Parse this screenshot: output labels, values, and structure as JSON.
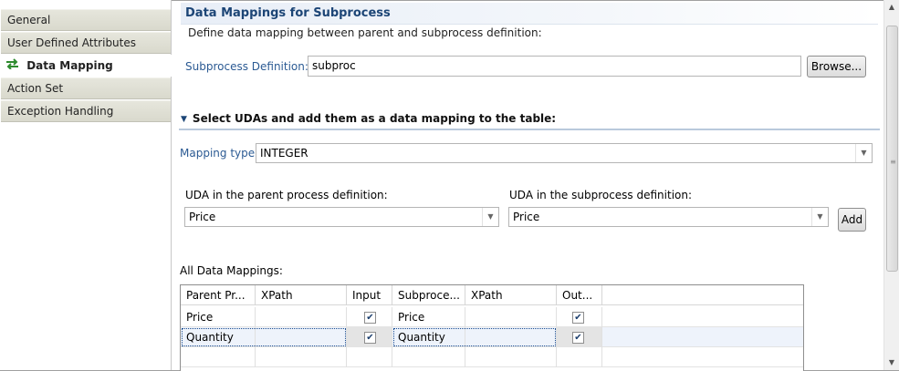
{
  "tabs": [
    {
      "label": "General",
      "active": false
    },
    {
      "label": "User Defined Attributes",
      "active": false
    },
    {
      "label": "Data Mapping",
      "active": true,
      "icon": "data-mapping-arrows-icon"
    },
    {
      "label": "Action Set",
      "active": false
    },
    {
      "label": "Exception Handling",
      "active": false
    }
  ],
  "section": {
    "title": "Data Mappings for Subprocess",
    "description": "Define data mapping between parent and subprocess definition:"
  },
  "subprocess": {
    "label": "Subprocess Definition:",
    "value": "subproc",
    "browse_label": "Browse..."
  },
  "uda_section": {
    "title": "Select UDAs and add them as a data mapping to the table:",
    "mapping_type_label": "Mapping type",
    "mapping_type_value": "INTEGER",
    "parent_label": "UDA in the parent process definition:",
    "parent_value": "Price",
    "sub_label": "UDA in the subprocess definition:",
    "sub_value": "Price",
    "add_label": "Add"
  },
  "mappings": {
    "label": "All Data Mappings:",
    "columns": [
      "Parent Pr...",
      "XPath",
      "Input",
      "Subproce...",
      "XPath",
      "Out..."
    ],
    "rows": [
      {
        "parent": "Price",
        "xpath1": "",
        "input": true,
        "sub": "Price",
        "xpath2": "",
        "output": true,
        "selected": false
      },
      {
        "parent": "Quantity",
        "xpath1": "",
        "input": true,
        "sub": "Quantity",
        "xpath2": "",
        "output": true,
        "selected": true
      }
    ]
  },
  "colors": {
    "label_blue": "#2b5a93",
    "title_blue": "#1c4576"
  }
}
